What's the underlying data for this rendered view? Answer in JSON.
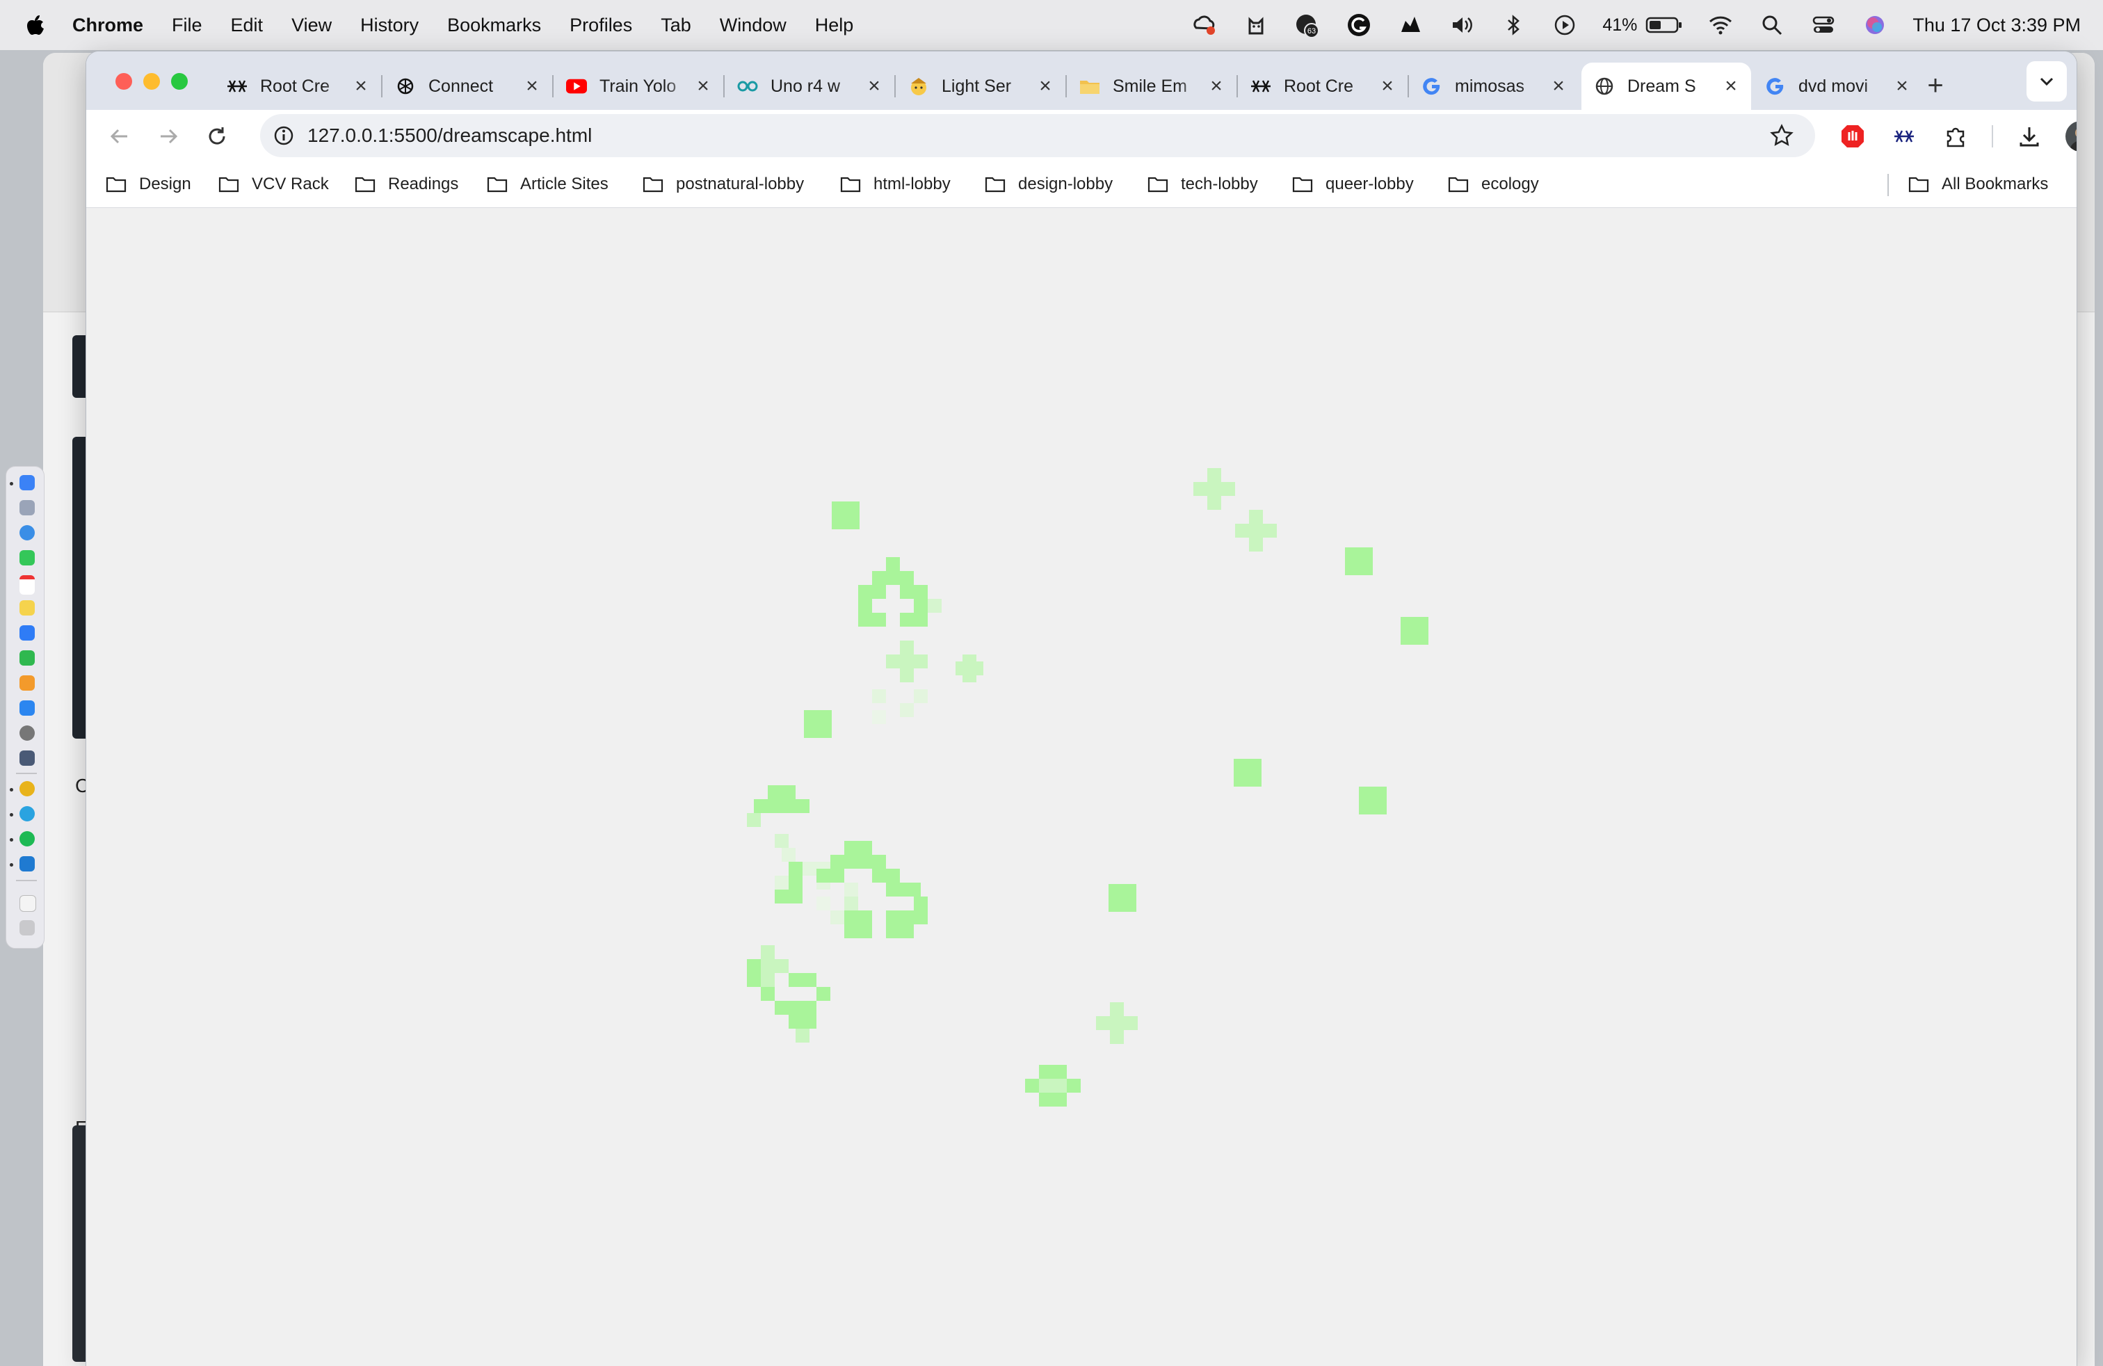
{
  "menubar": {
    "app_name": "Chrome",
    "items": [
      "File",
      "Edit",
      "View",
      "History",
      "Bookmarks",
      "Profiles",
      "Tab",
      "Window",
      "Help"
    ],
    "status_icons": [
      "creative-cloud-icon",
      "cat-icon",
      "notification-count-icon",
      "grammarly-icon",
      "cloud-icon",
      "volume-icon",
      "bluetooth-icon",
      "play-icon"
    ],
    "notification_count": "63",
    "battery_percent": "41%",
    "clock": "Thu 17 Oct  3:39 PM"
  },
  "tabs": [
    {
      "title": "Root Cre",
      "icon": "asterisk-icon",
      "active": false
    },
    {
      "title": "Connect",
      "icon": "openai-icon",
      "active": false
    },
    {
      "title": "Train Yolo",
      "icon": "youtube-icon",
      "active": false
    },
    {
      "title": "Uno r4 w",
      "icon": "arduino-icon",
      "active": false
    },
    {
      "title": "Light Ser",
      "icon": "emoji-icon",
      "active": false
    },
    {
      "title": "Smile Em",
      "icon": "folder-icon",
      "active": false
    },
    {
      "title": "Root Cre",
      "icon": "asterisk-icon",
      "active": false
    },
    {
      "title": "mimosas",
      "icon": "google-icon",
      "active": false
    },
    {
      "title": "Dream S",
      "icon": "globe-icon",
      "active": true
    },
    {
      "title": "dvd movi",
      "icon": "google-icon",
      "active": false
    }
  ],
  "address_bar": {
    "url": "127.0.0.1:5500/dreamscape.html"
  },
  "bookmarks": [
    "Design",
    "VCV Rack",
    "Readings",
    "Article Sites",
    "postnatural-lobby",
    "html-lobby",
    "design-lobby",
    "tech-lobby",
    "queer-lobby",
    "ecology"
  ],
  "all_bookmarks_label": "All Bookmarks",
  "background_window": {
    "partial_texts": [
      "C",
      "E"
    ]
  },
  "canvas": {
    "background": "#f0f0f0",
    "pixel_color": "#a9f49a",
    "description_free": true
  }
}
